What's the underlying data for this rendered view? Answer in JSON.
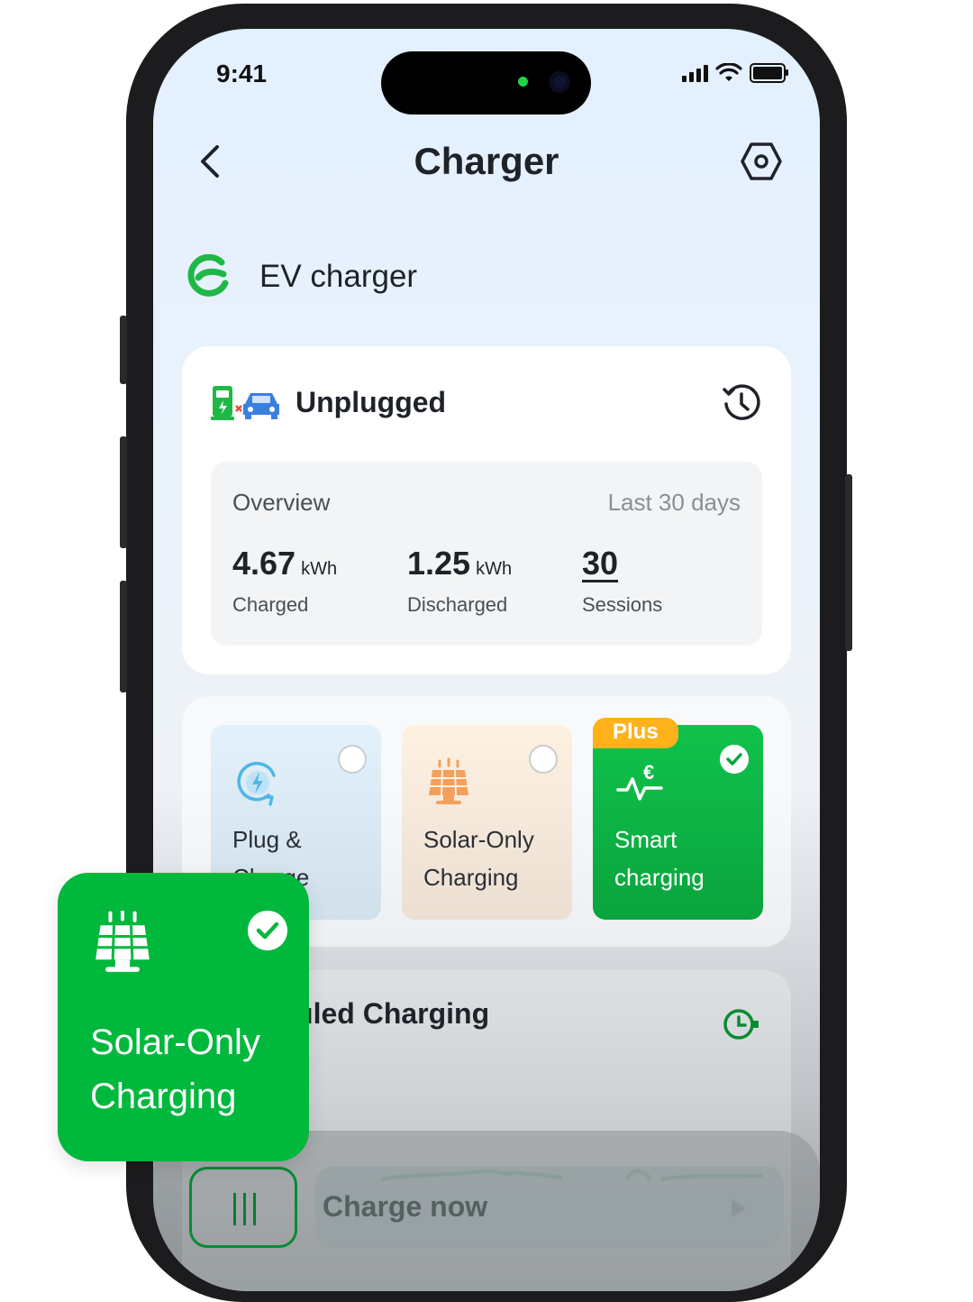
{
  "status_bar": {
    "time": "9:41"
  },
  "nav": {
    "title": "Charger"
  },
  "brand": {
    "title": "EV charger",
    "accent": "#1fb847"
  },
  "status": {
    "state": "Unplugged"
  },
  "overview": {
    "title": "Overview",
    "range": "Last 30 days",
    "stats": [
      {
        "value": "4.67",
        "unit": "kWh",
        "label": "Charged"
      },
      {
        "value": "1.25",
        "unit": "kWh",
        "label": "Discharged"
      },
      {
        "value": "30",
        "unit": "",
        "label": "Sessions"
      }
    ]
  },
  "modes": [
    {
      "label": "Plug & Charge",
      "icon": "plug-charge-icon",
      "selected": false
    },
    {
      "label": "Solar-Only Charging",
      "icon": "solar-panel-icon",
      "selected": false
    },
    {
      "label": "Smart charging",
      "icon": "euro-pulse-icon",
      "selected": true,
      "badge": "Plus"
    }
  ],
  "schedule": {
    "title": "Scheduled Charging"
  },
  "actions": {
    "charge_now": "Charge now"
  },
  "floating_card": {
    "label": "Solar-Only Charging",
    "icon": "solar-panel-icon",
    "selected": true
  },
  "colors": {
    "green": "#00b83c",
    "plus_badge": "#ffb21a",
    "solar_orange": "#f5a05a",
    "plug_blue": "#4fb6e8"
  }
}
